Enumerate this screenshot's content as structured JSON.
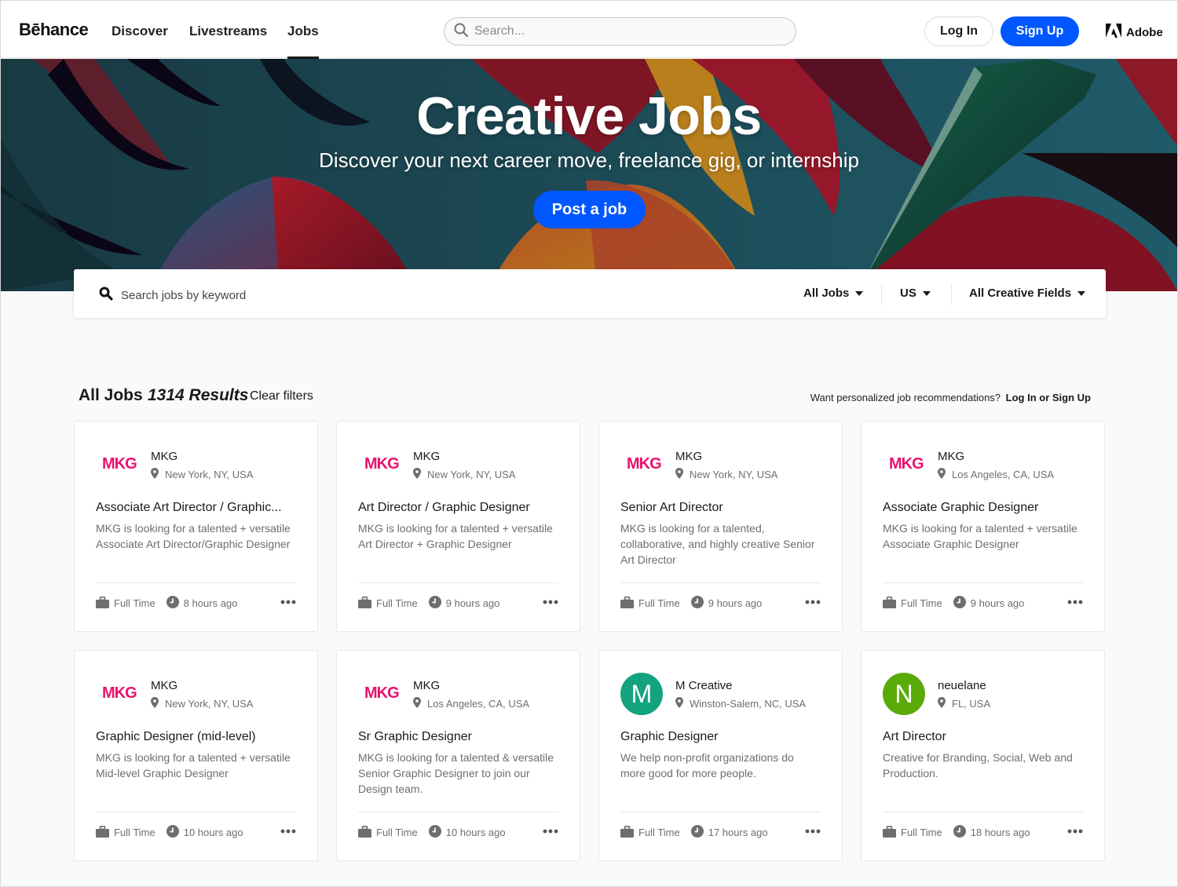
{
  "nav": {
    "logo": "Bēhance",
    "links": [
      {
        "label": "Discover",
        "active": false
      },
      {
        "label": "Livestreams",
        "active": false
      },
      {
        "label": "Jobs",
        "active": true
      }
    ],
    "search_placeholder": "Search...",
    "login_label": "Log In",
    "signup_label": "Sign Up",
    "adobe_label": "Adobe"
  },
  "hero": {
    "title": "Creative Jobs",
    "subtitle": "Discover your next career move, freelance gig, or internship",
    "post_job_label": "Post a job"
  },
  "filters": {
    "keyword_placeholder": "Search jobs by keyword",
    "job_type": "All Jobs",
    "country": "US",
    "field": "All Creative Fields"
  },
  "results": {
    "title": "All Jobs",
    "count": "1314 Results",
    "clear_label": "Clear filters",
    "promo_text": "Want personalized job recommendations?",
    "promo_link": "Log In or Sign Up"
  },
  "colors": {
    "accent": "#0057ff",
    "mkg_brand": "#e8126f",
    "avatar_m": "#14a37f",
    "avatar_n": "#5aaa0a"
  },
  "jobs": [
    {
      "company": "MKG",
      "logo": "MKG",
      "location": "New York, NY, USA",
      "title": "Associate Art Director / Graphic...",
      "description": "MKG is looking for a talented + versatile Associate Art Director/Graphic Designer",
      "type": "Full Time",
      "posted": "8 hours ago"
    },
    {
      "company": "MKG",
      "logo": "MKG",
      "location": "New York, NY, USA",
      "title": "Art Director / Graphic Designer",
      "description": "MKG is looking for a talented + versatile Art Director + Graphic Designer",
      "type": "Full Time",
      "posted": "9 hours ago"
    },
    {
      "company": "MKG",
      "logo": "MKG",
      "location": "New York, NY, USA",
      "title": "Senior Art Director",
      "description": "MKG is looking for a talented, collaborative, and highly creative Senior Art Director",
      "type": "Full Time",
      "posted": "9 hours ago"
    },
    {
      "company": "MKG",
      "logo": "MKG",
      "location": "Los Angeles, CA, USA",
      "title": "Associate Graphic Designer",
      "description": "MKG is looking for a talented + versatile Associate Graphic Designer",
      "type": "Full Time",
      "posted": "9 hours ago"
    },
    {
      "company": "MKG",
      "logo": "MKG",
      "location": "New York, NY, USA",
      "title": "Graphic Designer (mid-level)",
      "description": "MKG is looking for a talented + versatile Mid-level Graphic Designer",
      "type": "Full Time",
      "posted": "10 hours ago"
    },
    {
      "company": "MKG",
      "logo": "MKG",
      "location": "Los Angeles, CA, USA",
      "title": "Sr Graphic Designer",
      "description": "MKG is looking for a talented & versatile Senior Graphic Designer to join our Design team.",
      "type": "Full Time",
      "posted": "10 hours ago"
    },
    {
      "company": "M Creative",
      "avatar_letter": "M",
      "location": "Winston-Salem, NC, USA",
      "title": "Graphic Designer",
      "description": "We help non-profit organizations do more good for more people.",
      "type": "Full Time",
      "posted": "17 hours ago"
    },
    {
      "company": "neuelane",
      "avatar_letter": "N",
      "location": "FL, USA",
      "title": "Art Director",
      "description": "Creative for Branding, Social, Web and Production.",
      "type": "Full Time",
      "posted": "18 hours ago"
    }
  ]
}
